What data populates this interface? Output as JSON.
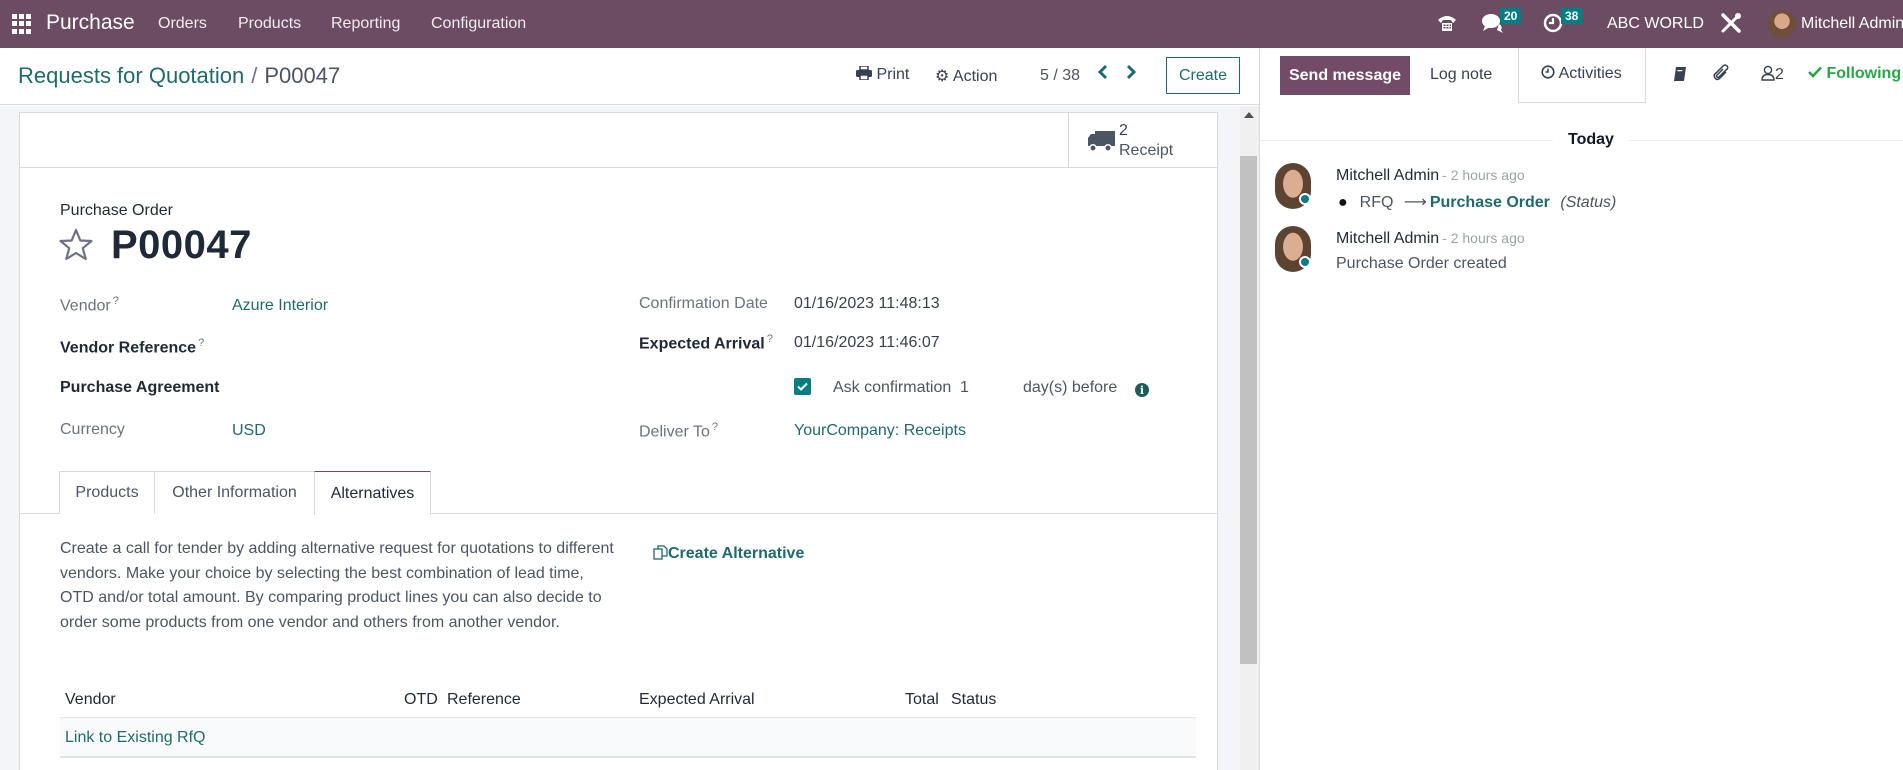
{
  "navbar": {
    "app_name": "Purchase",
    "menu": [
      "Orders",
      "Products",
      "Reporting",
      "Configuration"
    ],
    "messages_count": "20",
    "activities_count": "38",
    "company": "ABC WORLD",
    "user": "Mitchell Admin"
  },
  "control_panel": {
    "breadcrumb_parent": "Requests for Quotation",
    "breadcrumb_sep": "/",
    "breadcrumb_current": "P00047",
    "print_label": "Print",
    "action_label": "Action",
    "pager": "5 / 38",
    "create_label": "Create"
  },
  "button_box": {
    "receipt_count": "2",
    "receipt_label": "Receipt"
  },
  "form": {
    "title_label": "Purchase Order",
    "name": "P00047",
    "left_fields": [
      {
        "label": "Vendor",
        "help": "?",
        "value": "Azure Interior"
      },
      {
        "label": "Vendor Reference",
        "help": "?",
        "value": ""
      },
      {
        "label": "Purchase Agreement",
        "value": ""
      },
      {
        "label": "Currency",
        "value": "USD"
      }
    ],
    "right_fields": [
      {
        "label": "Confirmation Date",
        "value": "01/16/2023 11:48:13"
      },
      {
        "label": "Expected Arrival",
        "help": "?",
        "value": "01/16/2023 11:46:07"
      },
      {
        "label": "Deliver To",
        "help": "?",
        "value": "YourCompany: Receipts"
      }
    ],
    "ask_confirmation": {
      "checked": true,
      "label": "Ask confirmation",
      "days": "1",
      "suffix": "day(s) before"
    },
    "tabs": [
      {
        "label": "Products",
        "active": false
      },
      {
        "label": "Other Information",
        "active": false
      },
      {
        "label": "Alternatives",
        "active": true
      }
    ],
    "alternatives": {
      "description": "Create a call for tender by adding alternative request for quotations to different vendors. Make your choice by selecting the best combination of lead time, OTD and/or total amount. By comparing product lines you can also decide to order some products from one vendor and others from another vendor.",
      "create_button": "Create Alternative",
      "columns": [
        "Vendor",
        "OTD",
        "Reference",
        "Expected Arrival",
        "Total",
        "Status"
      ],
      "link_existing": "Link to Existing RfQ"
    }
  },
  "chatter": {
    "send_message": "Send message",
    "log_note": "Log note",
    "activities": "Activities",
    "followers_count": "2",
    "following": "Following",
    "date_separator": "Today",
    "messages": [
      {
        "author": "Mitchell Admin",
        "time": "- 2 hours ago",
        "old_value": "RFQ",
        "new_value": "Purchase Order",
        "field": "(Status)"
      },
      {
        "author": "Mitchell Admin",
        "time": "- 2 hours ago",
        "body": "Purchase Order created"
      }
    ]
  },
  "colors": {
    "navbar": "#6b4c63",
    "primary": "#714b67",
    "link": "#1f6a6e",
    "badge": "#017e84",
    "following": "#28a745"
  }
}
